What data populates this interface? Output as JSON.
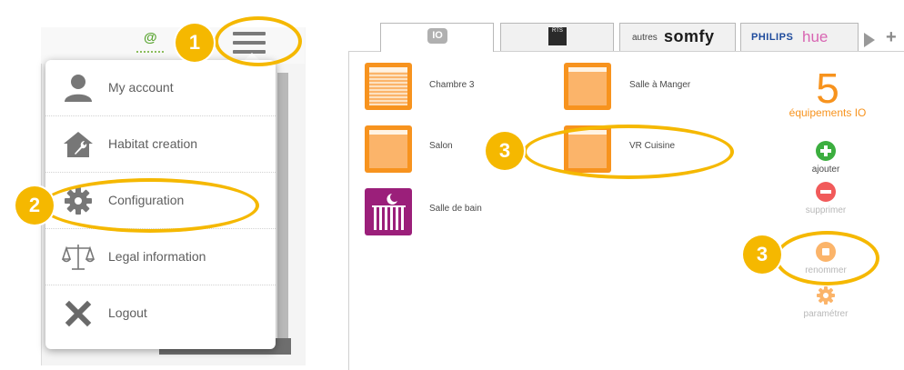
{
  "left_panel": {
    "menu_items": [
      {
        "label": "My account",
        "icon": "user-icon"
      },
      {
        "label": "Habitat creation",
        "icon": "house-wrench-icon"
      },
      {
        "label": "Configuration",
        "icon": "gear-icon"
      },
      {
        "label": "Legal information",
        "icon": "scales-icon"
      },
      {
        "label": "Logout",
        "icon": "close-icon"
      }
    ],
    "at_symbol": "@"
  },
  "tabs": [
    {
      "name": "io",
      "logo_text": "IO"
    },
    {
      "name": "rts",
      "logo_text": "RTS"
    },
    {
      "name": "somfy",
      "prefix": "autres",
      "brand": "somfy"
    },
    {
      "name": "hue",
      "brand_1": "PHILIPS",
      "brand_2": "hue"
    }
  ],
  "tab_extra": {
    "plus": "+"
  },
  "devices": [
    {
      "label": "Chambre 3",
      "icon": "roller-shutter-icon"
    },
    {
      "label": "Salle à Manger",
      "icon": "roller-shutter-icon"
    },
    {
      "label": "Salon",
      "icon": "roller-shutter-icon"
    },
    {
      "label": "VR Cuisine",
      "icon": "roller-shutter-icon"
    },
    {
      "label": "Salle de bain",
      "icon": "towel-radiator-icon"
    }
  ],
  "summary": {
    "count": "5",
    "label": "équipements IO"
  },
  "actions": [
    {
      "label": "ajouter",
      "color": "#3cae3f",
      "icon": "plus-circle-icon"
    },
    {
      "label": "supprimer",
      "color": "#f15a5a",
      "icon": "minus-circle-icon"
    },
    {
      "label": "renommer",
      "color": "#fbb46a",
      "icon": "rename-icon"
    },
    {
      "label": "paramétrer",
      "color": "#fbb46a",
      "icon": "gear-icon"
    }
  ],
  "annotations": {
    "step1": "1",
    "step2": "2",
    "step3a": "3",
    "step3b": "3",
    "color": "#f5b800"
  }
}
